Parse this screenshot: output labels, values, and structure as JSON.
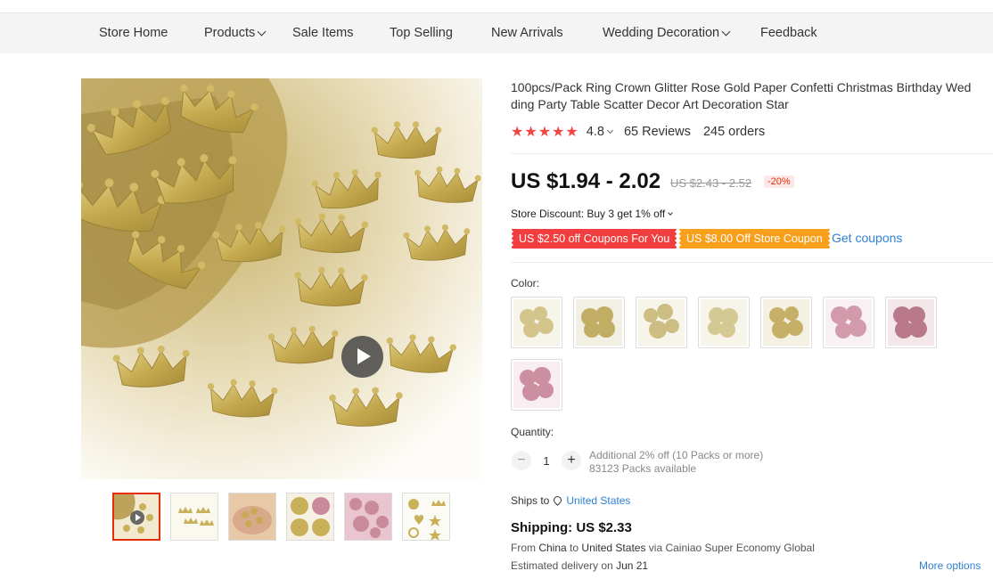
{
  "nav": {
    "items": [
      {
        "label": "Store Home"
      },
      {
        "label": "Products"
      },
      {
        "label": "Sale Items"
      },
      {
        "label": "Top Selling"
      },
      {
        "label": "New Arrivals"
      },
      {
        "label": "Wedding Decoration"
      },
      {
        "label": "Feedback"
      }
    ]
  },
  "product": {
    "title_line1": "100pcs/Pack Ring Crown Glitter Rose Gold Paper Confetti Christmas Birthday Wed",
    "title_line2": "ding Party Table Scatter Decor Art Decoration Star",
    "rating": "4.8",
    "reviews": "65 Reviews",
    "orders": "245 orders",
    "price": "US $1.94 - 2.02",
    "old_price": "US $2.43 - 2.52",
    "discount": "-20%",
    "store_discount": "Store Discount: Buy 3 get 1% off",
    "coupon1": "US $2.50 off Coupons For You",
    "coupon2": "US $8.00 Off Store Coupon",
    "get_coupons": "Get coupons",
    "color_label": "Color:",
    "quantity_label": "Quantity:",
    "quantity_value": "1",
    "qty_minus": "−",
    "qty_plus": "+",
    "qty_additional": "Additional 2% off (10 Packs or more)",
    "qty_available": "83123 Packs available",
    "ships_to_label": "Ships to",
    "ships_to_country": "United States",
    "shipping": "Shipping: US $2.33",
    "route_from": "From",
    "route_origin": "China",
    "route_to": "to",
    "route_dest": "United States",
    "route_via": "via Cainiao Super Economy Global",
    "est_label": "Estimated delivery on",
    "est_date": "Jun 21",
    "more_options": "More options"
  },
  "colors": {
    "star": "#f44444",
    "price_red": "#e62e04",
    "coupon_red": "#f23e3e",
    "coupon_orange": "#f89f1b",
    "link": "#2e81d4",
    "gold": "#c9b15a",
    "pink": "#c98a9c"
  },
  "icons": [
    "play-icon",
    "chevron-down-icon",
    "location-pin-icon",
    "minus-icon",
    "plus-icon",
    "star-icon"
  ],
  "swatches": [
    {
      "tone": "gold-pale"
    },
    {
      "tone": "gold"
    },
    {
      "tone": "gold-pale"
    },
    {
      "tone": "gold-pale"
    },
    {
      "tone": "gold"
    },
    {
      "tone": "pink"
    },
    {
      "tone": "rose"
    },
    {
      "tone": "pink"
    }
  ]
}
